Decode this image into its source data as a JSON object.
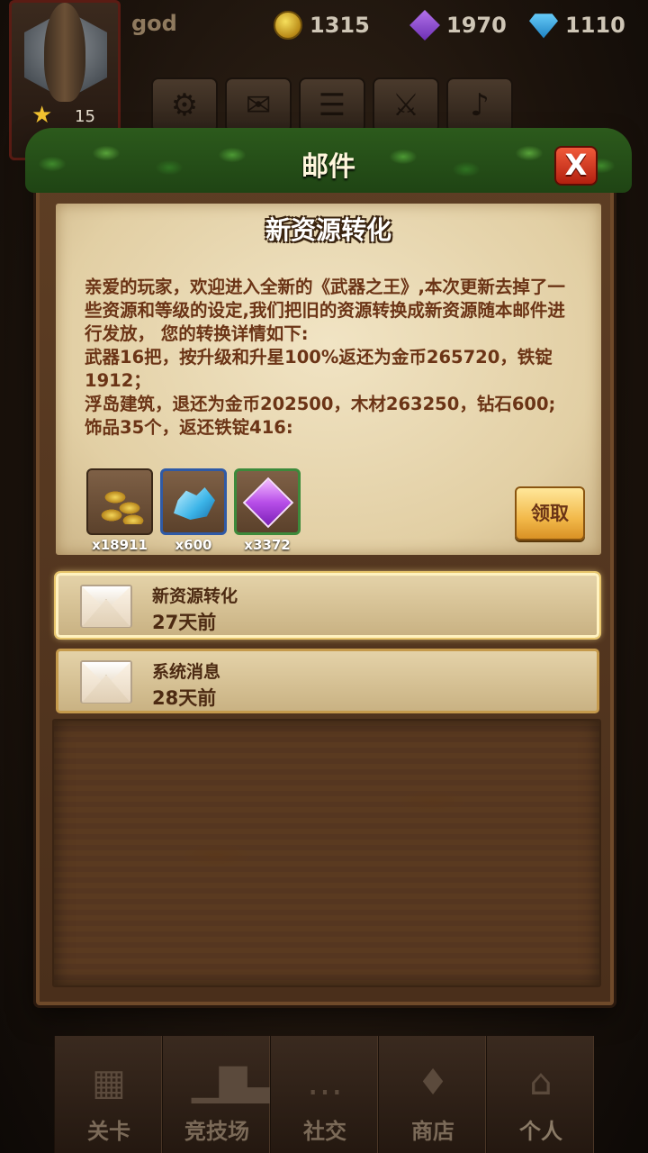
{
  "hud": {
    "player_name": "god",
    "star_count": "15",
    "coins": "1315",
    "gems": "1970",
    "diamonds": "1110",
    "tool_icons": [
      "gear-icon",
      "mail-icon",
      "list-icon",
      "swords-icon",
      "horn-icon"
    ]
  },
  "dialog": {
    "title": "邮件",
    "close_label": "X",
    "mail": {
      "subject": "新资源转化",
      "body_lines": [
        "亲爱的玩家，欢迎进入全新的《武器之王》,本次更新去掉了一些资源和等级的设定,我们把旧的资源转换成新资源随本邮件进行发放， 您的转换详情如下:",
        " 武器16把，按升级和升星100%返还为金币265720，铁锭1912；",
        " 浮岛建筑，退还为金币202500，木材263250，钻石600;",
        " 饰品35个，返还铁锭416:"
      ],
      "attachments": [
        {
          "icon": "gold-coins-icon",
          "qty": "x18911"
        },
        {
          "icon": "blue-crystal-icon",
          "qty": "x600"
        },
        {
          "icon": "purple-gem-icon",
          "qty": "x3372"
        }
      ],
      "claim_label": "领取"
    },
    "mail_list": [
      {
        "title": "新资源转化",
        "time": "27天前",
        "selected": true
      },
      {
        "title": "系统消息",
        "time": "28天前",
        "selected": false
      }
    ]
  },
  "bottom_nav": [
    {
      "label": "关卡",
      "icon": "grid-icon"
    },
    {
      "label": "竞技场",
      "icon": "podium-icon"
    },
    {
      "label": "社交",
      "icon": "chat-icon"
    },
    {
      "label": "商店",
      "icon": "sword-icon"
    },
    {
      "label": "个人",
      "icon": "house-icon"
    }
  ]
}
